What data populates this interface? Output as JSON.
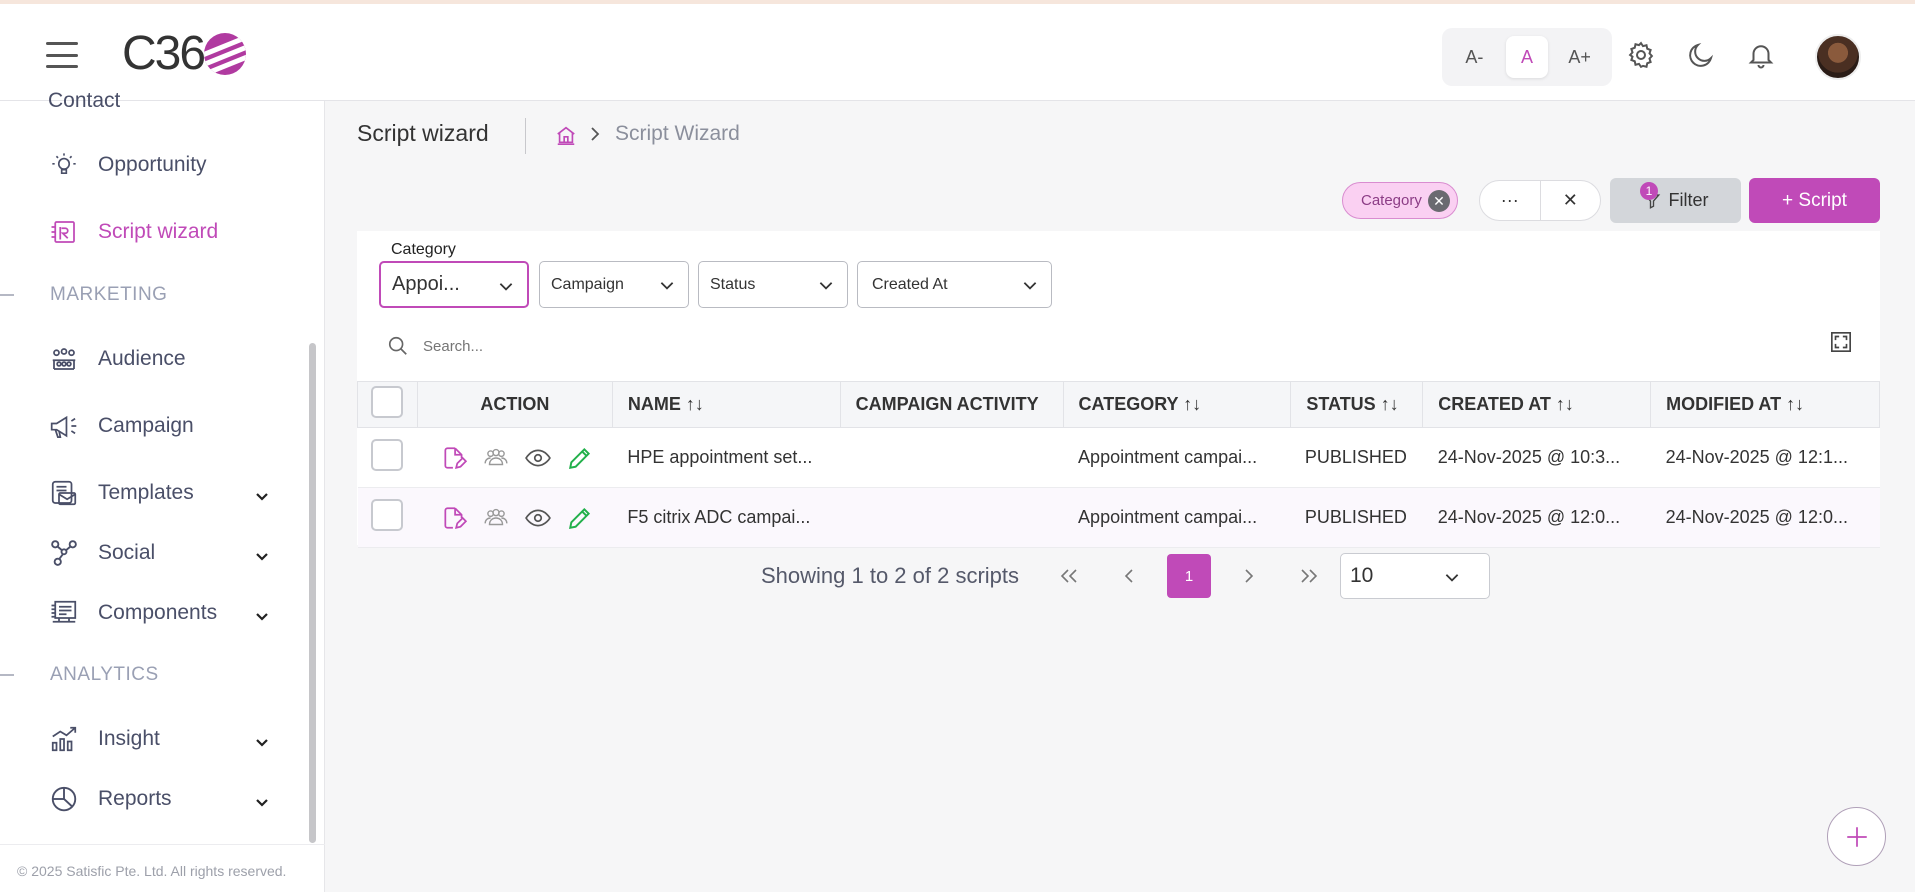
{
  "app": {
    "logo_text": "C36"
  },
  "header": {
    "font_small": "A-",
    "font_normal": "A",
    "font_large": "A+"
  },
  "sidebar": {
    "cut_item": "Contact",
    "items": [
      {
        "label": "Opportunity",
        "icon": "lightbulb-icon"
      },
      {
        "label": "Script wizard",
        "icon": "script-icon",
        "active": true
      },
      {
        "label": "Audience",
        "icon": "audience-icon"
      },
      {
        "label": "Campaign",
        "icon": "megaphone-icon"
      },
      {
        "label": "Templates",
        "icon": "template-icon",
        "expandable": true
      },
      {
        "label": "Social",
        "icon": "social-icon",
        "expandable": true
      },
      {
        "label": "Components",
        "icon": "components-icon",
        "expandable": true
      },
      {
        "label": "Insight",
        "icon": "insight-icon",
        "expandable": true
      },
      {
        "label": "Reports",
        "icon": "reports-icon",
        "expandable": true
      }
    ],
    "sections": {
      "marketing": "MARKETING",
      "analytics": "ANALYTICS"
    },
    "footer": "© 2025 Satisfic Pte. Ltd. All rights reserved."
  },
  "page": {
    "title": "Script wizard",
    "breadcrumb_current": "Script Wizard"
  },
  "toolbar": {
    "chip_label": "Category",
    "more": "···",
    "close": "✕",
    "filter_label": "Filter",
    "filter_count": "1",
    "add_label": "+ Script"
  },
  "filters": {
    "category_label": "Category",
    "category_value": "Appoi...",
    "campaign": "Campaign",
    "status": "Status",
    "created_at": "Created At",
    "search_placeholder": "Search..."
  },
  "table": {
    "headers": [
      "ACTION",
      "NAME ↑↓",
      "CAMPAIGN ACTIVITY",
      "CATEGORY ↑↓",
      "STATUS ↑↓",
      "CREATED AT ↑↓",
      "MODIFIED AT ↑↓"
    ],
    "rows": [
      {
        "name": "HPE appointment set...",
        "campaign_activity": "",
        "category": "Appointment campai...",
        "status": "PUBLISHED",
        "created_at": "24-Nov-2025 @ 10:3...",
        "modified_at": "24-Nov-2025 @ 12:1..."
      },
      {
        "name": "F5 citrix ADC campai...",
        "campaign_activity": "",
        "category": "Appointment campai...",
        "status": "PUBLISHED",
        "created_at": "24-Nov-2025 @ 12:0...",
        "modified_at": "24-Nov-2025 @ 12:0..."
      }
    ]
  },
  "pagination": {
    "summary": "Showing 1 to 2 of 2 scripts",
    "current_page": "1",
    "page_size": "10"
  },
  "colors": {
    "accent": "#c04ab8",
    "text_muted": "#9aa0b4",
    "action_green": "#22b04b"
  }
}
